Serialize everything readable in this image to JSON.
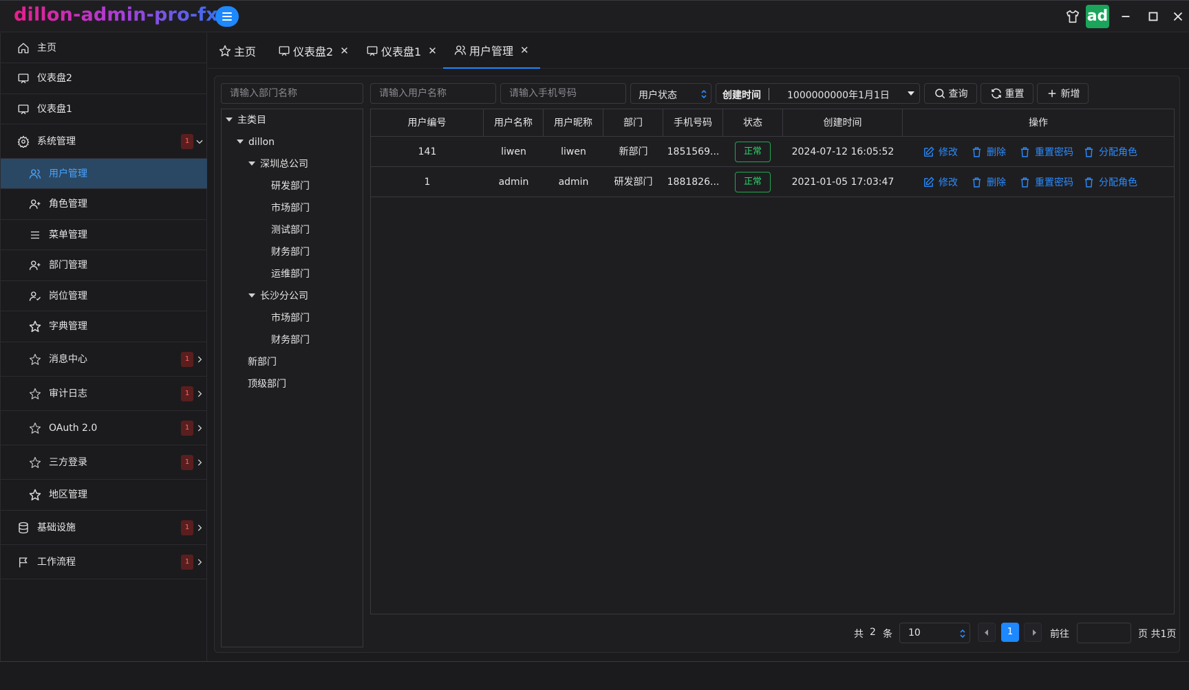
{
  "app": {
    "title": "dillon-admin-pro-fx",
    "avatar_text": "ad"
  },
  "colors": {
    "accent": "#1e88ff",
    "active_bg": "#2a4864",
    "success": "#2ed36a",
    "badge": "#ff6a6a"
  },
  "titlebar_icons": [
    "shirt-icon",
    "minimize-icon",
    "maximize-icon",
    "close-icon"
  ],
  "sidebar": {
    "items": [
      {
        "label": "主页",
        "icon": "home-icon"
      },
      {
        "label": "仪表盘2",
        "icon": "monitor-icon"
      },
      {
        "label": "仪表盘1",
        "icon": "monitor-icon"
      },
      {
        "label": "系统管理",
        "icon": "gear-icon",
        "badge": "1",
        "expanded": true
      },
      {
        "label": "用户管理",
        "icon": "users-icon",
        "active": true
      },
      {
        "label": "角色管理",
        "icon": "user-plus-icon"
      },
      {
        "label": "菜单管理",
        "icon": "list-icon"
      },
      {
        "label": "部门管理",
        "icon": "user-plus-icon"
      },
      {
        "label": "岗位管理",
        "icon": "user-check-icon"
      },
      {
        "label": "字典管理",
        "icon": "star-icon"
      },
      {
        "label": "消息中心",
        "icon": "star-outline-icon",
        "badge": "1"
      },
      {
        "label": "审计日志",
        "icon": "star-outline-icon",
        "badge": "1"
      },
      {
        "label": "OAuth 2.0",
        "icon": "star-outline-icon",
        "badge": "1"
      },
      {
        "label": "三方登录",
        "icon": "star-outline-icon",
        "badge": "1"
      },
      {
        "label": "地区管理",
        "icon": "star-icon"
      },
      {
        "label": "基础设施",
        "icon": "database-icon",
        "badge": "1"
      },
      {
        "label": "工作流程",
        "icon": "flag-icon",
        "badge": "1"
      }
    ]
  },
  "tabs": [
    {
      "label": "主页",
      "icon": "star-outline-icon",
      "closable": false
    },
    {
      "label": "仪表盘2",
      "icon": "monitor-icon",
      "closable": true
    },
    {
      "label": "仪表盘1",
      "icon": "monitor-icon",
      "closable": true
    },
    {
      "label": "用户管理",
      "icon": "users-icon",
      "closable": true,
      "active": true
    }
  ],
  "tab_close_glyph": "✕",
  "filters": {
    "dept_placeholder": "请输入部门名称",
    "username_placeholder": "请输入用户名称",
    "phone_placeholder": "请输入手机号码",
    "status_select": "用户状态",
    "created_label": "创建时间",
    "created_value": "1000000000年1月1日",
    "search_btn": "查询",
    "reset_btn": "重置",
    "add_btn": "新增"
  },
  "tree": {
    "root": "主类目",
    "nodes": [
      {
        "label": "dillon",
        "level": 1,
        "expanded": true
      },
      {
        "label": "深圳总公司",
        "level": 2,
        "expanded": true
      },
      {
        "label": "研发部门",
        "level": 3
      },
      {
        "label": "市场部门",
        "level": 3
      },
      {
        "label": "测试部门",
        "level": 3
      },
      {
        "label": "财务部门",
        "level": 3
      },
      {
        "label": "运维部门",
        "level": 3
      },
      {
        "label": "长沙分公司",
        "level": 2,
        "expanded": true
      },
      {
        "label": "市场部门",
        "level": 3
      },
      {
        "label": "财务部门",
        "level": 3
      },
      {
        "label": "新部门",
        "level": 1
      },
      {
        "label": "顶级部门",
        "level": 1
      }
    ]
  },
  "table": {
    "headers": [
      "用户编号",
      "用户名称",
      "用户昵称",
      "部门",
      "手机号码",
      "状态",
      "创建时间",
      "操作"
    ],
    "rows": [
      {
        "id": "141",
        "username": "liwen",
        "nickname": "liwen",
        "dept": "新部门",
        "phone": "1851569...",
        "status": "正常",
        "created": "2024-07-12 16:05:52"
      },
      {
        "id": "1",
        "username": "admin",
        "nickname": "admin",
        "dept": "研发部门",
        "phone": "1881826...",
        "status": "正常",
        "created": "2021-01-05 17:03:47"
      }
    ],
    "actions": [
      "修改",
      "删除",
      "重置密码",
      "分配角色"
    ]
  },
  "pagination": {
    "total_prefix": "共",
    "total": "2",
    "total_suffix": "条",
    "page_size": "10",
    "current_page": "1",
    "goto_label": "前往",
    "page_suffix": "页 共1页"
  }
}
